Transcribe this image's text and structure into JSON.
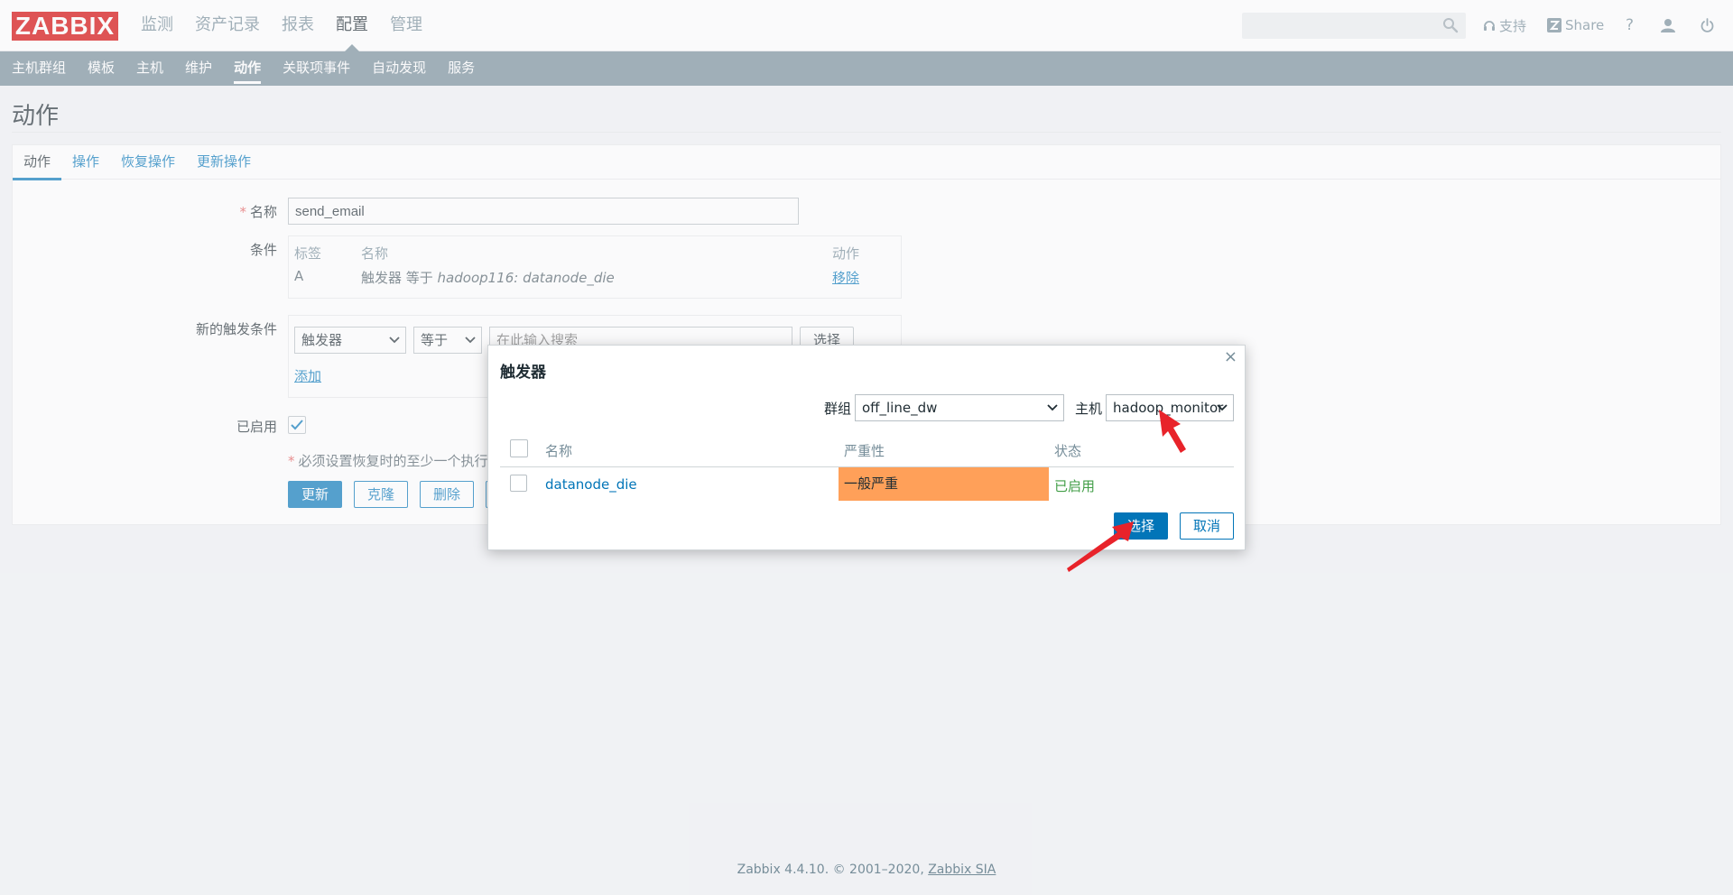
{
  "header": {
    "logo": "ZABBIX",
    "menu": [
      "监测",
      "资产记录",
      "报表",
      "配置",
      "管理"
    ],
    "active_menu": "配置",
    "search": {
      "value": "",
      "placeholder": ""
    },
    "links": {
      "support": "支持",
      "share": "Share",
      "help": "?"
    }
  },
  "subnav": {
    "items": [
      "主机群组",
      "模板",
      "主机",
      "维护",
      "动作",
      "关联项事件",
      "自动发现",
      "服务"
    ],
    "active": "动作"
  },
  "page": {
    "title": "动作",
    "tabs": [
      "动作",
      "操作",
      "恢复操作",
      "更新操作"
    ],
    "form": {
      "name_label": "名称",
      "name_value": "send_email",
      "conditions_label": "条件",
      "conditions": {
        "headers": {
          "label": "标签",
          "name": "名称",
          "action": "动作"
        },
        "rows": [
          {
            "label": "A",
            "name_prefix": "触发器 等于 ",
            "name_value": "hadoop116: datanode_die",
            "action": "移除"
          }
        ]
      },
      "new_condition_label": "新的触发条件",
      "new_condition": {
        "type": "触发器",
        "operator": "等于",
        "search_placeholder": "在此输入搜索",
        "select_button": "选择",
        "add_link": "添加"
      },
      "enabled_label": "已启用",
      "note": "必须设置恢复时的至少一个执行",
      "buttons": {
        "update": "更新",
        "clone": "克隆",
        "delete": "删除"
      }
    }
  },
  "dialog": {
    "title": "触发器",
    "group_label": "群组",
    "group_value": "off_line_dw",
    "host_label": "主机",
    "host_value": "hadoop_monitor",
    "columns": {
      "name": "名称",
      "severity": "严重性",
      "status": "状态"
    },
    "rows": [
      {
        "name": "datanode_die",
        "severity": "一般严重",
        "status": "已启用",
        "severity_color": "#ffa059"
      }
    ],
    "buttons": {
      "select": "选择",
      "cancel": "取消"
    }
  },
  "footer": {
    "text": "Zabbix 4.4.10. © 2001–2020, ",
    "link": "Zabbix SIA"
  },
  "colors": {
    "brand": "#d40000",
    "accent": "#0275b8",
    "subnav": "#768d99",
    "annotation_arrow": "#e8232a"
  }
}
